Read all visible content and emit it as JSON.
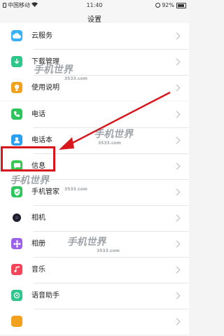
{
  "status_bar": {
    "carrier": "中国移动",
    "time": "11:40",
    "battery": "92%"
  },
  "nav": {
    "title": "设置"
  },
  "group1": [
    {
      "label": "云服务",
      "icon": "cloud-service-icon",
      "color": "#3ab0f5"
    },
    {
      "label": "下载管理",
      "icon": "download-icon",
      "color": "#2ec68a"
    },
    {
      "label": "使用说明",
      "icon": "bulb-icon",
      "color": "#f2a11f"
    }
  ],
  "group2": [
    {
      "label": "电话",
      "icon": "phone-icon",
      "color": "#2ec65c"
    },
    {
      "label": "电话本",
      "icon": "contacts-icon",
      "color": "#2b9ff0"
    },
    {
      "label": "信息",
      "icon": "message-icon",
      "color": "#38cb53"
    },
    {
      "label": "手机管家",
      "icon": "shield-icon",
      "color": "#2ec65c"
    },
    {
      "label": "相机",
      "icon": "camera-icon",
      "color": "#1c1c2a"
    },
    {
      "label": "相册",
      "icon": "gallery-icon",
      "color": "#9a62e6"
    },
    {
      "label": "音乐",
      "icon": "music-icon",
      "color": "#f4445a"
    },
    {
      "label": "语音助手",
      "icon": "voice-assistant-icon",
      "color": "#2ec68a"
    },
    {
      "label": "",
      "icon": "app-icon",
      "color": "#f2a11f"
    }
  ],
  "watermark": {
    "brand": "手机世界",
    "site": "3533.com"
  }
}
